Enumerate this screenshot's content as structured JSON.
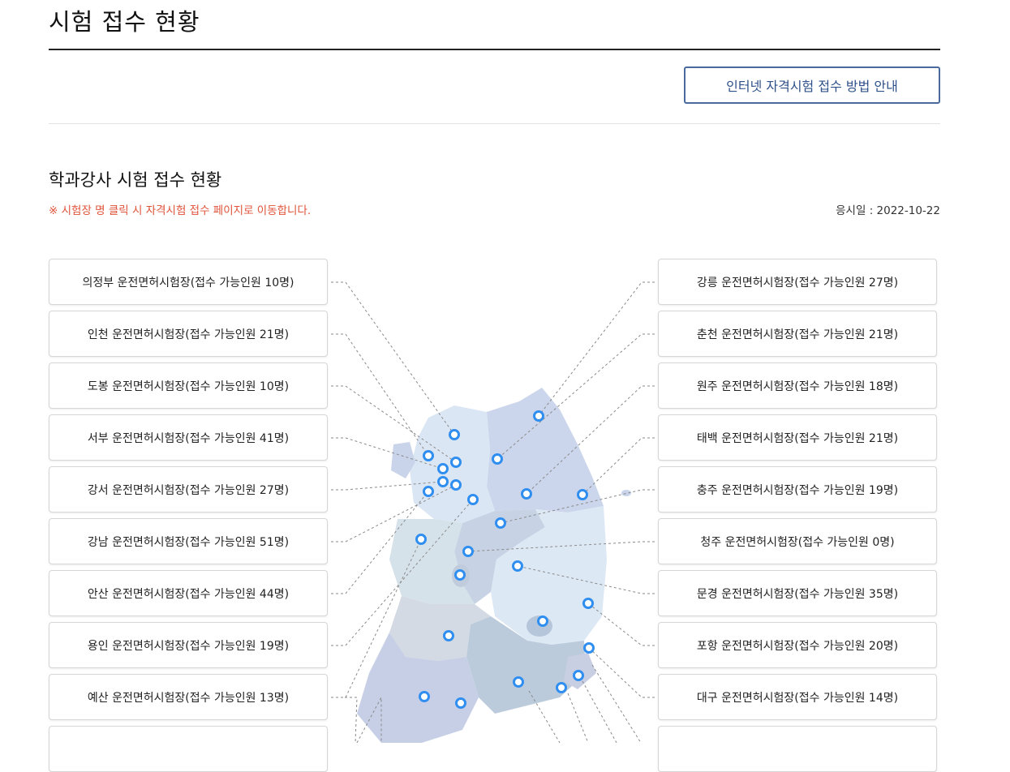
{
  "header": {
    "title": "시험 접수 현황"
  },
  "guide_button": {
    "label": "인터넷 자격시험 접수 방법 안내"
  },
  "section": {
    "title": "학과강사 시험 접수 현황",
    "notice": "※ 시험장 명 클릭 시 자격시험 접수 페이지로 이동합니다.",
    "exam_date": "응시일 : 2022-10-22"
  },
  "left_sites": [
    {
      "label": "의정부 운전면허시험장(접수 가능인원 10명)"
    },
    {
      "label": "인천 운전면허시험장(접수 가능인원 21명)"
    },
    {
      "label": "도봉 운전면허시험장(접수 가능인원 10명)"
    },
    {
      "label": "서부 운전면허시험장(접수 가능인원 41명)"
    },
    {
      "label": "강서 운전면허시험장(접수 가능인원 27명)"
    },
    {
      "label": "강남 운전면허시험장(접수 가능인원 51명)"
    },
    {
      "label": "안산 운전면허시험장(접수 가능인원 44명)"
    },
    {
      "label": "용인 운전면허시험장(접수 가능인원 19명)"
    },
    {
      "label": "예산 운전면허시험장(접수 가능인원 13명)"
    },
    {
      "label": ""
    }
  ],
  "right_sites": [
    {
      "label": "강릉 운전면허시험장(접수 가능인원 27명)"
    },
    {
      "label": "춘천 운전면허시험장(접수 가능인원 21명)"
    },
    {
      "label": "원주 운전면허시험장(접수 가능인원 18명)"
    },
    {
      "label": "태백 운전면허시험장(접수 가능인원 21명)"
    },
    {
      "label": "충주 운전면허시험장(접수 가능인원 19명)"
    },
    {
      "label": "청주 운전면허시험장(접수 가능인원 0명)"
    },
    {
      "label": "문경 운전면허시험장(접수 가능인원 35명)"
    },
    {
      "label": "포항 운전면허시험장(접수 가능인원 20명)"
    },
    {
      "label": "대구 운전면허시험장(접수 가능인원 14명)"
    },
    {
      "label": ""
    }
  ],
  "colors": {
    "accent": "#2f5189",
    "notice": "#e0533a",
    "marker": "#2f8ef0",
    "map_light": "#dbe6f4",
    "map_mid": "#c9d4ea",
    "map_gray": "#c7ced8"
  }
}
